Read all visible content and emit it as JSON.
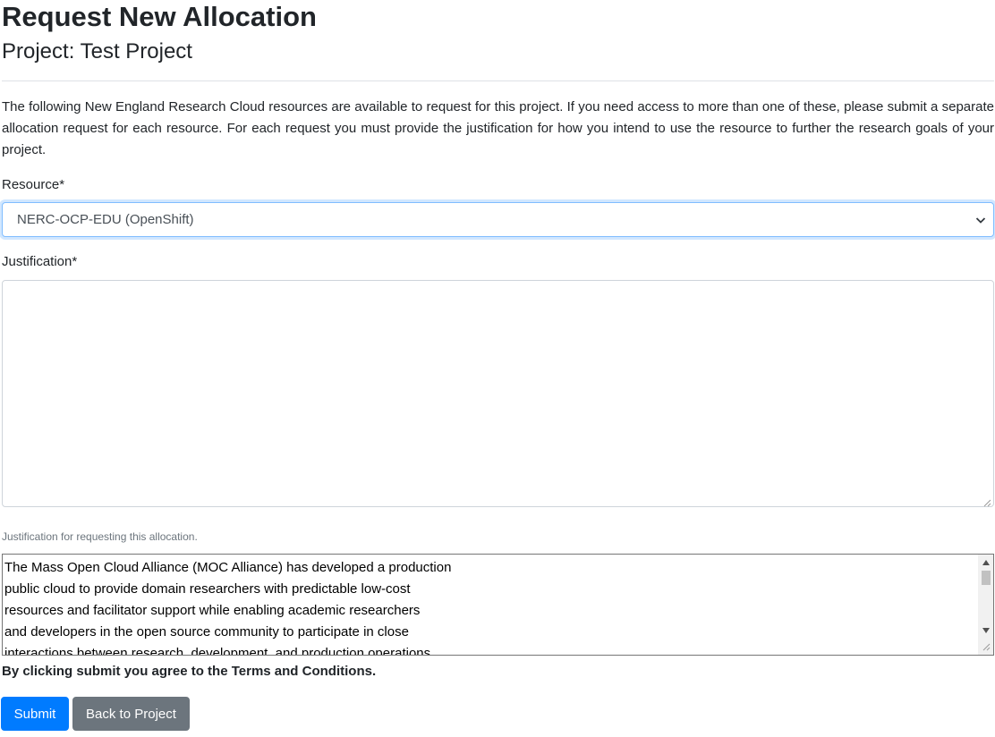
{
  "header": {
    "title": "Request New Allocation",
    "subtitle": "Project: Test Project"
  },
  "intro": "The following New England Research Cloud resources are available to request for this project. If you need access to more than one of these, please submit a separate allocation request for each resource. For each request you must provide the justification for how you intend to use the resource to further the research goals of your project.",
  "form": {
    "resource": {
      "label": "Resource*",
      "selected": "NERC-OCP-EDU (OpenShift)"
    },
    "justification": {
      "label": "Justification*",
      "value": "",
      "help": "Justification for requesting this allocation."
    },
    "terms": {
      "text": "The Mass Open Cloud Alliance (MOC Alliance) has developed a production\npublic cloud to provide domain researchers with predictable low-cost\nresources and facilitator support while enabling academic researchers\nand developers in the open source community to participate in close\ninteractions between research, development, and production operations."
    },
    "agreement": "By clicking submit you agree to the Terms and Conditions.",
    "buttons": {
      "submit": "Submit",
      "back": "Back to Project"
    }
  },
  "colors": {
    "primary": "#007bff",
    "secondary": "#6c757d",
    "text": "#212529",
    "muted": "#6c757d",
    "border": "#ced4da",
    "focus_border": "#80bdff"
  },
  "icons": {
    "select_arrow": "chevron-down-icon",
    "scroll_up": "triangle-up-icon",
    "scroll_down": "triangle-down-icon",
    "resize": "resize-grip-icon"
  }
}
